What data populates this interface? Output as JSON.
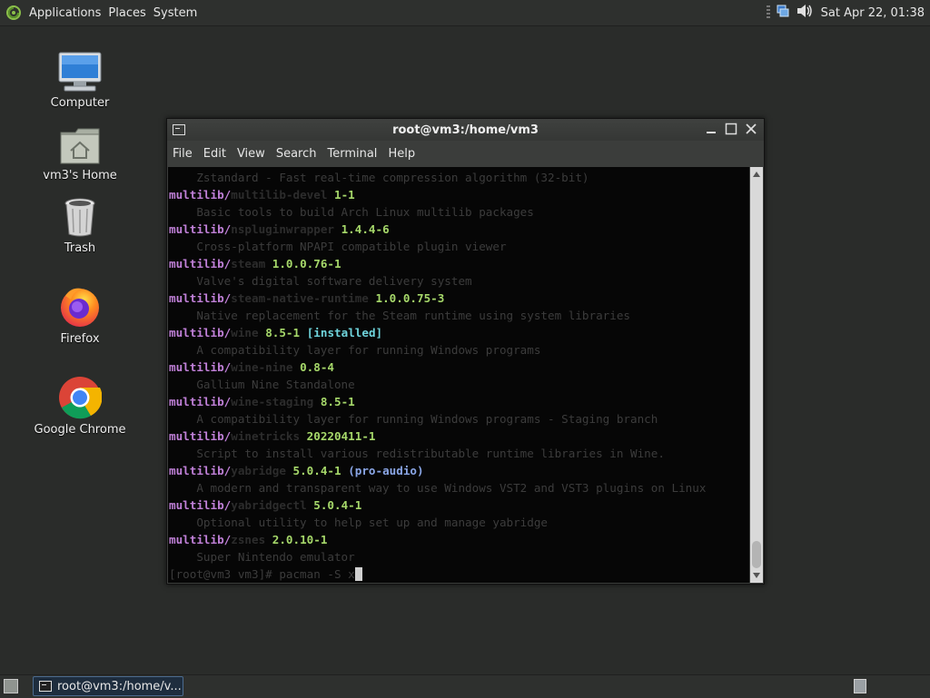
{
  "top_panel": {
    "menus": [
      "Applications",
      "Places",
      "System"
    ],
    "clock": "Sat Apr 22, 01:38"
  },
  "desktop_icons": [
    "Computer",
    "vm3's Home",
    "Trash",
    "Firefox",
    "Google Chrome"
  ],
  "window": {
    "title": "root@vm3:/home/vm3",
    "menus": [
      "File",
      "Edit",
      "View",
      "Search",
      "Terminal",
      "Help"
    ]
  },
  "terminal": {
    "lines": [
      {
        "type": "desc",
        "text": "    Zstandard - Fast real-time compression algorithm (32-bit)"
      },
      {
        "type": "pkg",
        "repo": "multilib/",
        "name": "multilib-devel",
        "version": "1-1",
        "tag": "",
        "tag_type": ""
      },
      {
        "type": "desc",
        "text": "    Basic tools to build Arch Linux multilib packages"
      },
      {
        "type": "pkg",
        "repo": "multilib/",
        "name": "nspluginwrapper",
        "version": "1.4.4-6",
        "tag": "",
        "tag_type": ""
      },
      {
        "type": "desc",
        "text": "    Cross-platform NPAPI compatible plugin viewer"
      },
      {
        "type": "pkg",
        "repo": "multilib/",
        "name": "steam",
        "version": "1.0.0.76-1",
        "tag": "",
        "tag_type": ""
      },
      {
        "type": "desc",
        "text": "    Valve's digital software delivery system"
      },
      {
        "type": "pkg",
        "repo": "multilib/",
        "name": "steam-native-runtime",
        "version": "1.0.0.75-3",
        "tag": "",
        "tag_type": ""
      },
      {
        "type": "desc",
        "text": "    Native replacement for the Steam runtime using system libraries"
      },
      {
        "type": "pkg",
        "repo": "multilib/",
        "name": "wine",
        "version": "8.5-1",
        "tag": "[installed]",
        "tag_type": "installed"
      },
      {
        "type": "desc",
        "text": "    A compatibility layer for running Windows programs"
      },
      {
        "type": "pkg",
        "repo": "multilib/",
        "name": "wine-nine",
        "version": "0.8-4",
        "tag": "",
        "tag_type": ""
      },
      {
        "type": "desc",
        "text": "    Gallium Nine Standalone"
      },
      {
        "type": "pkg",
        "repo": "multilib/",
        "name": "wine-staging",
        "version": "8.5-1",
        "tag": "",
        "tag_type": ""
      },
      {
        "type": "desc",
        "text": "    A compatibility layer for running Windows programs - Staging branch"
      },
      {
        "type": "pkg",
        "repo": "multilib/",
        "name": "winetricks",
        "version": "20220411-1",
        "tag": "",
        "tag_type": ""
      },
      {
        "type": "desc",
        "text": "    Script to install various redistributable runtime libraries in Wine."
      },
      {
        "type": "pkg",
        "repo": "multilib/",
        "name": "yabridge",
        "version": "5.0.4-1",
        "tag": "(pro-audio)",
        "tag_type": "group"
      },
      {
        "type": "desc",
        "text": "    A modern and transparent way to use Windows VST2 and VST3 plugins on Linux"
      },
      {
        "type": "pkg",
        "repo": "multilib/",
        "name": "yabridgectl",
        "version": "5.0.4-1",
        "tag": "",
        "tag_type": ""
      },
      {
        "type": "desc",
        "text": "    Optional utility to help set up and manage yabridge"
      },
      {
        "type": "pkg",
        "repo": "multilib/",
        "name": "zsnes",
        "version": "2.0.10-1",
        "tag": "",
        "tag_type": ""
      },
      {
        "type": "desc",
        "text": "    Super Nintendo emulator"
      }
    ],
    "prompt": "[root@vm3 vm3]# pacman -S x"
  },
  "taskbar": {
    "task_label": "root@vm3:/home/v..."
  },
  "colors": {
    "repo": "#c080d8",
    "version": "#a6d86a",
    "installed_tag": "#6fd4dc",
    "group_tag": "#8aa6e6"
  }
}
